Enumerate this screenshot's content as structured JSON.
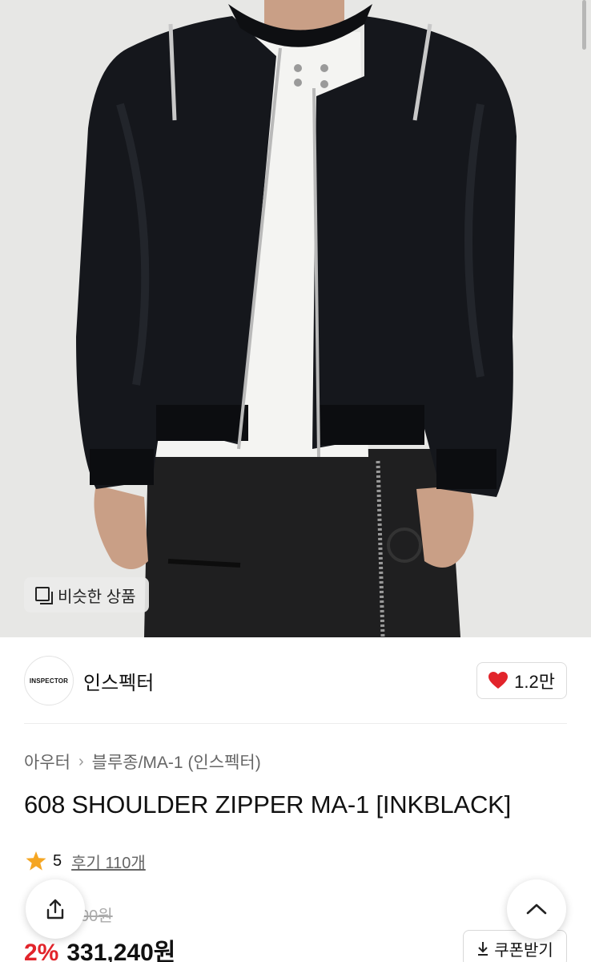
{
  "hero": {
    "similar_label": "비슷한 상품",
    "colors": {
      "background": "#e7e7e5",
      "jacket": "#15171c",
      "shirt": "#f4f4f2",
      "skin": "#c99f86",
      "pants": "#1f1f20"
    }
  },
  "brand": {
    "logo_text": "INSPECTOR",
    "name": "인스펙터",
    "like_count": "1.2만",
    "heart_color": "#e2242b"
  },
  "breadcrumb": {
    "category": "아우터",
    "subcategory": "블루종/MA-1 (인스펙터)"
  },
  "product": {
    "title": "608 SHOULDER ZIPPER MA-1 [INKBLACK]",
    "rating": "5",
    "reviews": "후기 110개",
    "original_price_visible": "00원",
    "discount": "2%",
    "price": "331,240원"
  },
  "actions": {
    "coupon_label": "쿠폰받기",
    "share_icon": "share-icon",
    "scroll_top_icon": "chevron-up-icon"
  }
}
